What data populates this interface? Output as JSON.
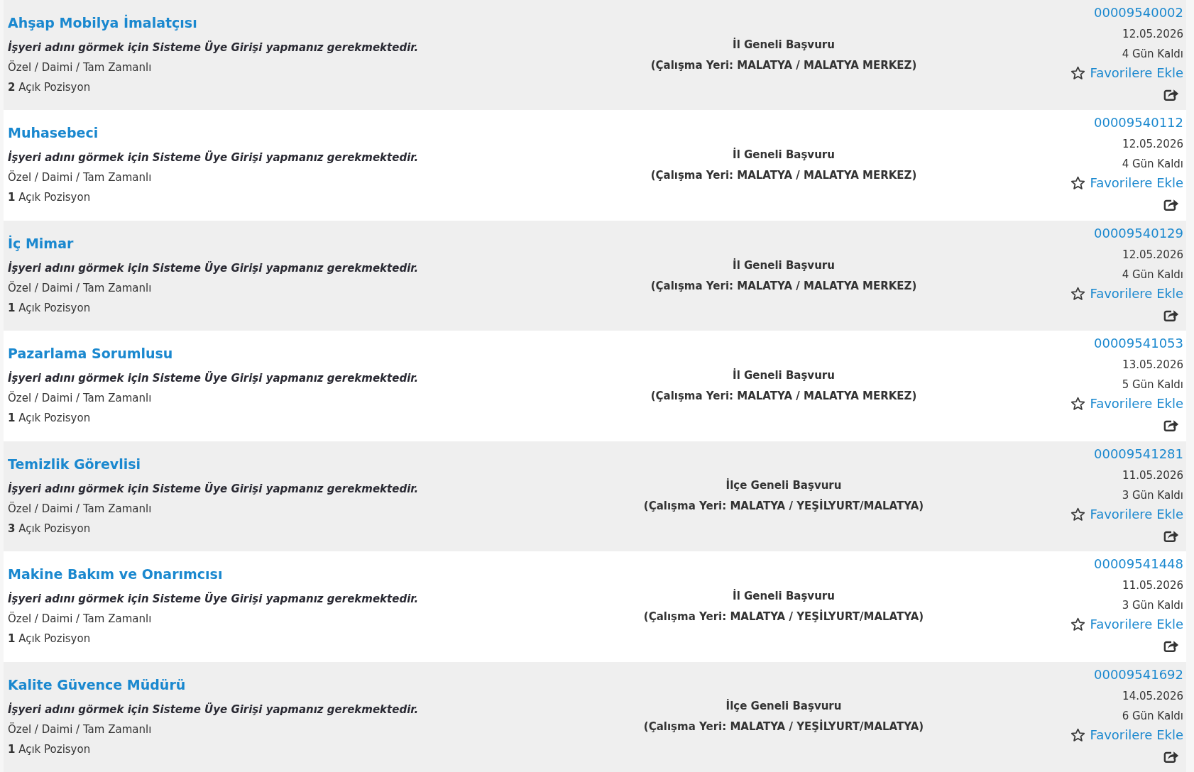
{
  "job_listings": [
    {
      "title": "Ahşap Mobilya İmalatçısı",
      "employer_notice": "İşyeri adını görmek için Sisteme Üye Girişi yapmanız gerekmektedir.",
      "employment_type": "Özel / Daimi / Tam Zamanlı",
      "open_positions": "**2** Açık Pozisyon",
      "application_scope": "İl Geneli Başvuru",
      "work_location": "(Çalışma Yeri: MALATYA / MALATYA MERKEZ)",
      "listing_number": "00009540002",
      "deadline_date": "12.05.2026",
      "days_left": "4 Gün Kaldı",
      "favorite_label": "Favorilere Ekle",
      "favorited": false
    },
    {
      "title": "Muhasebeci",
      "employer_notice": "İşyeri adını görmek için Sisteme Üye Girişi yapmanız gerekmektedir.",
      "employment_type": "Özel / Daimi / Tam Zamanlı",
      "open_positions": "**1** Açık Pozisyon",
      "application_scope": "İl Geneli Başvuru",
      "work_location": "(Çalışma Yeri: MALATYA / MALATYA MERKEZ)",
      "listing_number": "00009540112",
      "deadline_date": "12.05.2026",
      "days_left": "4 Gün Kaldı",
      "favorite_label": "Favorilere Ekle",
      "favorited": false
    },
    {
      "title": "İç Mimar",
      "employer_notice": "İşyeri adını görmek için Sisteme Üye Girişi yapmanız gerekmektedir.",
      "employment_type": "Özel / Daimi / Tam Zamanlı",
      "open_positions": "**1** Açık Pozisyon",
      "application_scope": "İl Geneli Başvuru",
      "work_location": "(Çalışma Yeri: MALATYA / MALATYA MERKEZ)",
      "listing_number": "00009540129",
      "deadline_date": "12.05.2026",
      "days_left": "4 Gün Kaldı",
      "favorite_label": "Favorilere Ekle",
      "favorited": false
    },
    {
      "title": "Pazarlama Sorumlusu",
      "employer_notice": "İşyeri adını görmek için Sisteme Üye Girişi yapmanız gerekmektedir.",
      "employment_type": "Özel / Daimi / Tam Zamanlı",
      "open_positions": "**1** Açık Pozisyon",
      "application_scope": "İl Geneli Başvuru",
      "work_location": "(Çalışma Yeri: MALATYA / MALATYA MERKEZ)",
      "listing_number": "00009541053",
      "deadline_date": "13.05.2026",
      "days_left": "5 Gün Kaldı",
      "favorite_label": "Favorilere Ekle",
      "favorited": false
    },
    {
      "title": "Temizlik Görevlisi",
      "employer_notice": "İşyeri adını görmek için Sisteme Üye Girişi yapmanız gerekmektedir.",
      "employment_type": "Özel / Daimi / Tam Zamanlı",
      "open_positions": "**3** Açık Pozisyon",
      "application_scope": "İlçe Geneli Başvuru",
      "work_location": "(Çalışma Yeri: MALATYA / YEŞİLYURT/MALATYA)",
      "listing_number": "00009541281",
      "deadline_date": "11.05.2026",
      "days_left": "3 Gün Kaldı",
      "favorite_label": "Favorilere Ekle",
      "favorited": false
    },
    {
      "title": "Makine Bakım ve Onarımcısı",
      "employer_notice": "İşyeri adını görmek için Sisteme Üye Girişi yapmanız gerekmektedir.",
      "employment_type": "Özel / Daimi / Tam Zamanlı",
      "open_positions": "**1** Açık Pozisyon",
      "application_scope": "İl Geneli Başvuru",
      "work_location": "(Çalışma Yeri: MALATYA / YEŞİLYURT/MALATYA)",
      "listing_number": "00009541448",
      "deadline_date": "11.05.2026",
      "days_left": "3 Gün Kaldı",
      "favorite_label": "Favorilere Ekle",
      "favorited": false
    },
    {
      "title": "Kalite Güvence Müdürü",
      "employer_notice": "İşyeri adını görmek için Sisteme Üye Girişi yapmanız gerekmektedir.",
      "employment_type": "Özel / Daimi / Tam Zamanlı",
      "open_positions": "**1** Açık Pozisyon",
      "application_scope": "İlçe Geneli Başvuru",
      "work_location": "(Çalışma Yeri: MALATYA / YEŞİLYURT/MALATYA)",
      "listing_number": "00009541692",
      "deadline_date": "14.05.2026",
      "days_left": "6 Gün Kaldı",
      "favorite_label": "Favorilere Ekle",
      "favorited": false
    }
  ]
}
